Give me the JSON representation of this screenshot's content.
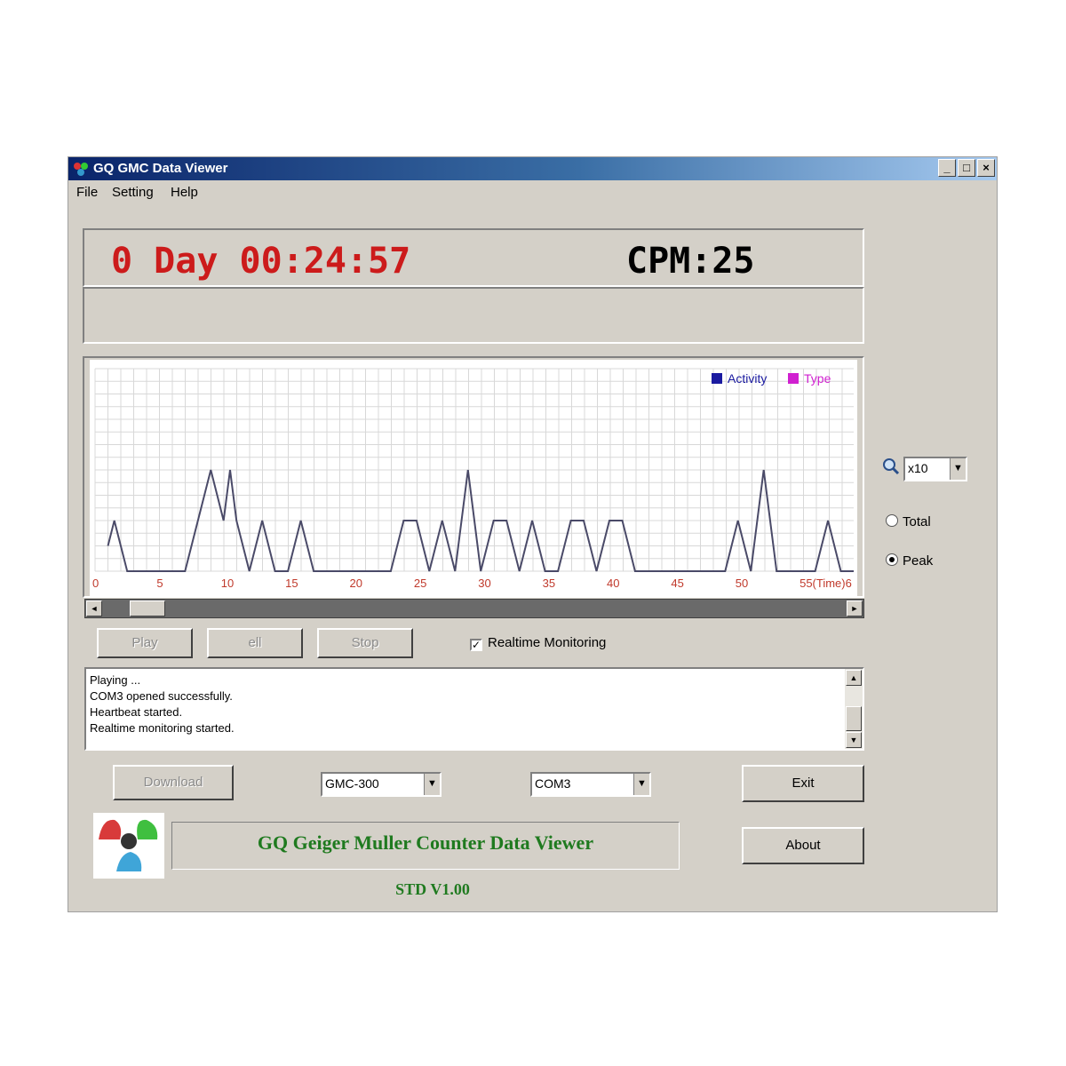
{
  "window": {
    "title": "GQ GMC Data Viewer",
    "title_buttons": [
      "_",
      "□",
      "×"
    ]
  },
  "menu": {
    "file": "File",
    "setting": "Setting",
    "help": "Help"
  },
  "status": {
    "timer": "0 Day 00:24:57",
    "cpm": "CPM:25",
    "timer_color": "#cc1b1b"
  },
  "chart_data": {
    "type": "line",
    "legend": [
      "Activity",
      "Type"
    ],
    "legend_colors": [
      "#1a1aa0",
      "#d020d0"
    ],
    "line_color": "#4a4a68",
    "x_ticks": [
      "0",
      "5",
      "10",
      "15",
      "20",
      "25",
      "30",
      "35",
      "40",
      "45",
      "50",
      "55(Time)6"
    ],
    "tick_color": "#c0392b",
    "xlim": [
      0,
      59
    ],
    "ylim": [
      0,
      40
    ],
    "grid": true,
    "series": [
      {
        "x": [
          1,
          1.5,
          2.5,
          3,
          4,
          5,
          6,
          7,
          8,
          9,
          10,
          10.5,
          11,
          12,
          13,
          14,
          15,
          16,
          17,
          18,
          19,
          20,
          21,
          22,
          23,
          24,
          25,
          26,
          27,
          28,
          29,
          30,
          31,
          32,
          33,
          34,
          35,
          36,
          37,
          38,
          39,
          40,
          41,
          42,
          43,
          44,
          45,
          46,
          47,
          48,
          49,
          50,
          51,
          52,
          53,
          54,
          55,
          56,
          57,
          58,
          59
        ],
        "y": [
          5,
          10,
          0,
          0,
          0,
          0,
          0,
          0,
          10,
          20,
          10,
          20,
          10,
          0,
          10,
          0,
          0,
          10,
          0,
          0,
          0,
          0,
          0,
          0,
          0,
          10,
          10,
          0,
          10,
          0,
          20,
          0,
          10,
          10,
          0,
          10,
          0,
          0,
          10,
          10,
          0,
          10,
          10,
          0,
          0,
          0,
          0,
          0,
          0,
          0,
          0,
          10,
          0,
          20,
          0,
          0,
          0,
          0,
          10,
          0,
          0
        ]
      }
    ]
  },
  "zoom": {
    "value": "x10",
    "arrow": "▼"
  },
  "radios": {
    "total": "Total",
    "peak": "Peak",
    "selected": "peak"
  },
  "hscroll": {
    "left": "◄",
    "right": "►"
  },
  "controls": {
    "play": "Play",
    "pause": "ell",
    "stop": "Stop",
    "realtime_label": "Realtime Monitoring",
    "realtime_checked": true,
    "check_mark": "✓"
  },
  "log": {
    "lines": [
      "Playing ...",
      "COM3 opened successfully.",
      "Heartbeat started.",
      "Realtime monitoring started."
    ],
    "up": "▲",
    "down": "▼"
  },
  "bottom": {
    "download": "Download",
    "device": "GMC-300",
    "port": "COM3",
    "exit": "Exit",
    "about": "About",
    "banner": "GQ Geiger Muller Counter Data Viewer",
    "version": "STD V1.00",
    "accent_color": "#1f7a1f"
  }
}
